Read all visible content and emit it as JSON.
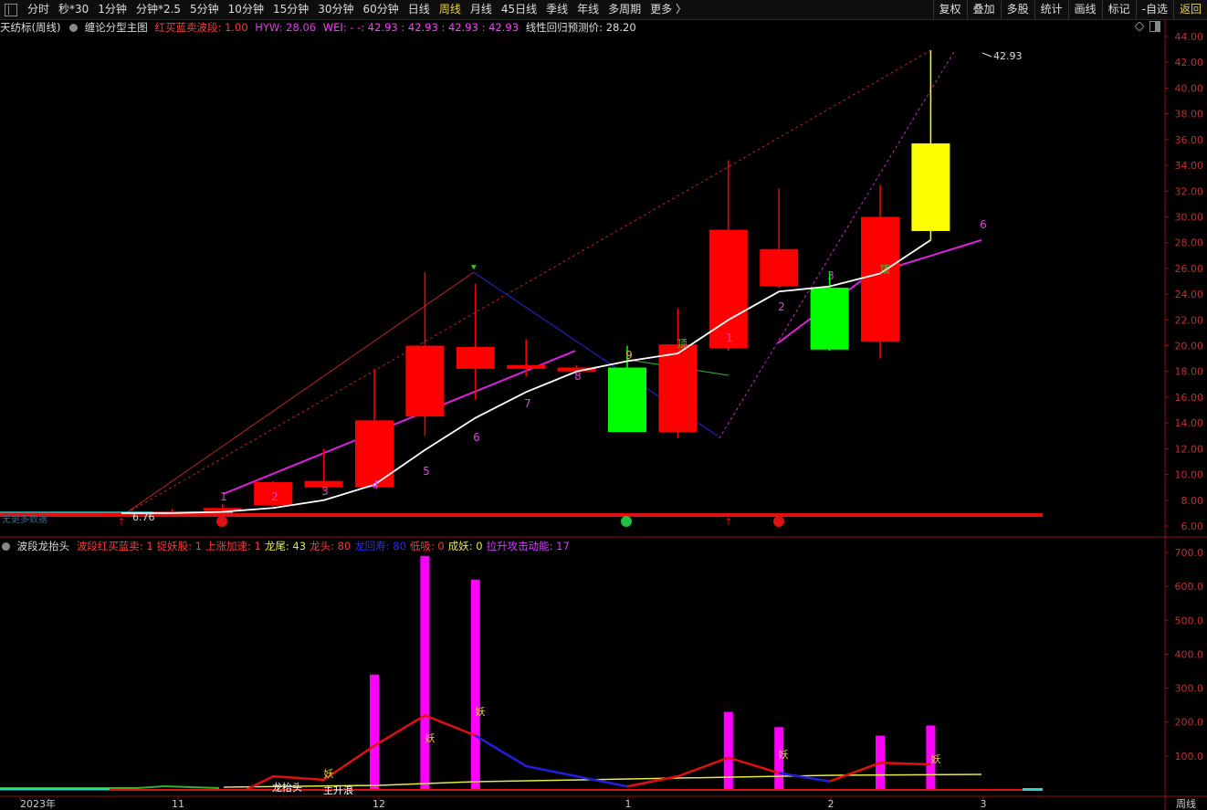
{
  "toolbar": {
    "items": [
      "分时",
      "秒*30",
      "1分钟",
      "分钟*2.5",
      "5分钟",
      "10分钟",
      "15分钟",
      "30分钟",
      "60分钟",
      "日线",
      "周线",
      "月线",
      "45日线",
      "季线",
      "年线",
      "多周期",
      "更多 〉"
    ],
    "active": "周线",
    "right": [
      "复权",
      "叠加",
      "多股",
      "统计",
      "画线",
      "标记",
      "-自选",
      "返回"
    ]
  },
  "main_title": {
    "stock": "天纺标(周线)",
    "indicator": "缠论分型主图",
    "red_buy": "红买蓝卖波段: 1.00",
    "hyw": "HYW: 28.06",
    "wei_prefix": "WEI: - -: 42.93 : 42.93 : 42.93 : 42.93",
    "regression": "线性回归预测价: 28.20"
  },
  "sub_title": {
    "name": "波段龙抬头",
    "items": [
      {
        "text": "波段红买蓝卖: 1",
        "color": "#ff3b3b"
      },
      {
        "text": "捉妖股: 1",
        "color": "#ff3b3b"
      },
      {
        "text": "上涨加速: 1",
        "color": "#ff3b3b"
      },
      {
        "text": "龙尾: 43",
        "color": "#e8e84a"
      },
      {
        "text": "龙头: 80",
        "color": "#ff3b3b"
      },
      {
        "text": "龙回寿: 80",
        "color": "#2a2aff"
      },
      {
        "text": "低吸: 0",
        "color": "#ff3b3b"
      },
      {
        "text": "成妖: 0",
        "color": "#e8e84a"
      },
      {
        "text": "拉升攻击动能: 17",
        "color": "#d040ff"
      }
    ]
  },
  "main_axis": {
    "ticks": [
      "44.00",
      "42.00",
      "40.00",
      "38.00",
      "36.00",
      "34.00",
      "32.00",
      "30.00",
      "28.00",
      "26.00",
      "24.00",
      "22.00",
      "20.00",
      "18.00",
      "16.00",
      "14.00",
      "12.00",
      "10.00",
      "8.00",
      "6.00"
    ]
  },
  "sub_axis": {
    "ticks": [
      "700.0",
      "600.0",
      "500.0",
      "400.0",
      "300.0",
      "200.0",
      "100.0"
    ]
  },
  "x_labels": [
    "2023年",
    "11",
    "12",
    "1",
    "2",
    "3"
  ],
  "period_label": "周线",
  "price_labels": {
    "high": "42.93",
    "low": "6.76"
  },
  "chart_texts": {
    "top_mark": "顶",
    "numbers": [
      "1",
      "2",
      "3",
      "4",
      "5",
      "6",
      "7",
      "8",
      "9",
      "1",
      "2",
      "3",
      "6"
    ],
    "yao": "妖",
    "dragon_head": "龙抬头",
    "main_wave": "主升浪",
    "no_data": "无更多数据"
  },
  "chart_data": {
    "type": "candlestick",
    "candles": [
      {
        "o": 6.9,
        "c": 6.95,
        "h": 7.0,
        "l": 6.8,
        "color": "red"
      },
      {
        "o": 7.0,
        "c": 7.1,
        "h": 7.3,
        "l": 6.9,
        "color": "red"
      },
      {
        "o": 7.2,
        "c": 7.4,
        "h": 7.7,
        "l": 7.0,
        "color": "red"
      },
      {
        "o": 7.6,
        "c": 9.4,
        "h": 9.5,
        "l": 7.5,
        "color": "red"
      },
      {
        "o": 9.0,
        "c": 9.5,
        "h": 12.0,
        "l": 8.8,
        "color": "red"
      },
      {
        "o": 9.0,
        "c": 14.2,
        "h": 18.2,
        "l": 8.9,
        "color": "red"
      },
      {
        "o": 14.5,
        "c": 20.0,
        "h": 25.7,
        "l": 13.0,
        "color": "red"
      },
      {
        "o": 18.2,
        "c": 19.9,
        "h": 24.8,
        "l": 15.8,
        "color": "red"
      },
      {
        "o": 18.2,
        "c": 18.5,
        "h": 20.5,
        "l": 17.6,
        "color": "red"
      },
      {
        "o": 18.0,
        "c": 18.3,
        "h": 18.5,
        "l": 17.8,
        "color": "red"
      },
      {
        "o": 18.3,
        "c": 13.3,
        "h": 20.0,
        "l": 13.3,
        "color": "green"
      },
      {
        "o": 13.3,
        "c": 20.1,
        "h": 22.9,
        "l": 12.8,
        "color": "red"
      },
      {
        "o": 19.8,
        "c": 29.0,
        "h": 34.4,
        "l": 19.6,
        "color": "red"
      },
      {
        "o": 24.6,
        "c": 27.5,
        "h": 32.2,
        "l": 24.5,
        "color": "red"
      },
      {
        "o": 24.5,
        "c": 19.7,
        "h": 25.7,
        "l": 19.6,
        "color": "green"
      },
      {
        "o": 20.3,
        "c": 30.0,
        "h": 32.5,
        "l": 19.0,
        "color": "red"
      },
      {
        "o": 28.9,
        "c": 35.7,
        "h": 42.93,
        "l": 28.2,
        "color": "yellow"
      }
    ],
    "ma_white": [
      7.0,
      7.0,
      7.1,
      7.4,
      8.0,
      9.2,
      11.9,
      14.4,
      16.4,
      18.0,
      18.8,
      19.4,
      22.0,
      24.2,
      24.6,
      25.6,
      28.2
    ],
    "sub_bars": [
      0,
      0,
      0,
      0,
      0,
      340,
      690,
      620,
      0,
      0,
      0,
      0,
      230,
      185,
      0,
      160,
      190
    ],
    "sub_red_line": [
      0,
      0,
      0,
      40,
      30,
      130,
      220,
      160,
      70,
      40,
      10,
      40,
      95,
      50,
      25,
      80,
      75
    ],
    "ylim_main": [
      6.0,
      44.0
    ],
    "ylim_sub": [
      0,
      700
    ]
  }
}
